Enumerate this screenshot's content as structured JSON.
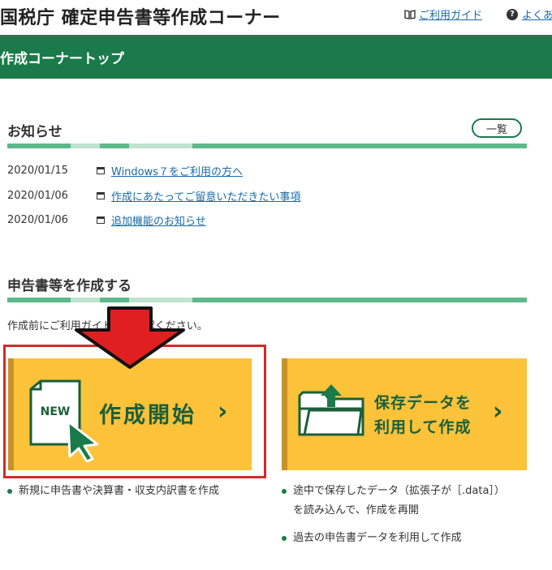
{
  "header": {
    "site_title": "国税庁 確定申告書等作成コーナー",
    "guide_link": "ご利用ガイド",
    "faq_link": "よくあ"
  },
  "top_bar": {
    "title": "作成コーナートップ"
  },
  "news": {
    "title": "お知らせ",
    "list_button": "一覧",
    "items": [
      {
        "date": "2020/01/15",
        "text": "Windows７をご利用の方へ"
      },
      {
        "date": "2020/01/06",
        "text": "作成にあたってご留意いただきたい事項"
      },
      {
        "date": "2020/01/06",
        "text": "追加機能のお知らせ"
      }
    ]
  },
  "create": {
    "title": "申告書等を作成する",
    "intro": "作成前にご利用ガイドをご確認ください。",
    "new_button": {
      "badge": "NEW",
      "label": "作成開始",
      "description": "新規に申告書や決算書・収支内訳書を作成"
    },
    "saved_button": {
      "label_line1": "保存データを",
      "label_line2": "利用して作成",
      "bullets": [
        {
          "line1": "途中で保存したデータ（拡張子が［.data］）",
          "line2": "を読み込んで、作成を再開"
        },
        {
          "line1": "過去の申告書データを利用して作成",
          "line2": ""
        }
      ]
    }
  },
  "colors": {
    "brand_green": "#1a7a4a",
    "button_yellow": "#fbc23a",
    "highlight_red": "#d22a2a"
  }
}
